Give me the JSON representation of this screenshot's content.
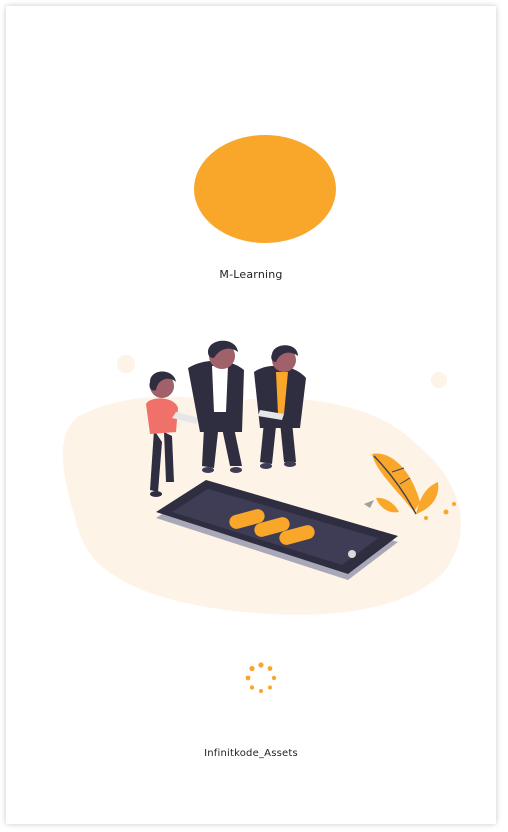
{
  "app": {
    "name": "M-Learning",
    "footer": "Infinitkode_Assets"
  },
  "colors": {
    "accent": "#F9A72B",
    "background": "#FFFFFF",
    "blob": "#FDF3E6",
    "phone_dark": "#2F2E41",
    "shirt_pink": "#F0706A"
  },
  "icons": {
    "logo": "circle-logo",
    "loader": "loading-spinner-icon",
    "hero": "people-phone-illustration"
  }
}
